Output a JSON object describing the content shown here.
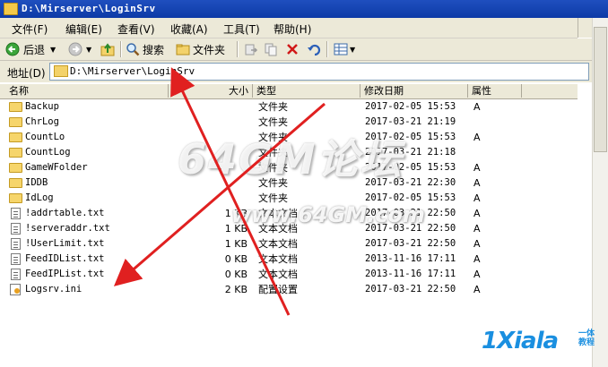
{
  "window": {
    "title": "D:\\Mirserver\\LoginSrv"
  },
  "menu": [
    "文件(F)",
    "编辑(E)",
    "查看(V)",
    "收藏(A)",
    "工具(T)",
    "帮助(H)"
  ],
  "toolbar": {
    "back": "后退",
    "search": "搜索",
    "folders": "文件夹"
  },
  "address": {
    "label": "地址(D)",
    "value": "D:\\Mirserver\\LoginSrv"
  },
  "columns": {
    "name": "名称",
    "size": "大小",
    "type": "类型",
    "modified": "修改日期",
    "attr": "属性"
  },
  "files": [
    {
      "name": "Backup",
      "size": "",
      "type": "文件夹",
      "date": "2017-02-05 15:53",
      "attr": "A",
      "kind": "folder"
    },
    {
      "name": "ChrLog",
      "size": "",
      "type": "文件夹",
      "date": "2017-03-21 21:19",
      "attr": "",
      "kind": "folder"
    },
    {
      "name": "CountLo",
      "size": "",
      "type": "文件夹",
      "date": "2017-02-05 15:53",
      "attr": "A",
      "kind": "folder"
    },
    {
      "name": "CountLog",
      "size": "",
      "type": "文件夹",
      "date": "2017-03-21 21:18",
      "attr": "",
      "kind": "folder"
    },
    {
      "name": "GameWFolder",
      "size": "",
      "type": "文件夹",
      "date": "2017-02-05 15:53",
      "attr": "A",
      "kind": "folder"
    },
    {
      "name": "IDDB",
      "size": "",
      "type": "文件夹",
      "date": "2017-03-21 22:30",
      "attr": "A",
      "kind": "folder"
    },
    {
      "name": "IdLog",
      "size": "",
      "type": "文件夹",
      "date": "2017-02-05 15:53",
      "attr": "A",
      "kind": "folder"
    },
    {
      "name": "!addrtable.txt",
      "size": "1 KB",
      "type": "文本文档",
      "date": "2017-03-21 22:50",
      "attr": "A",
      "kind": "file"
    },
    {
      "name": "!serveraddr.txt",
      "size": "1 KB",
      "type": "文本文档",
      "date": "2017-03-21 22:50",
      "attr": "A",
      "kind": "file"
    },
    {
      "name": "!UserLimit.txt",
      "size": "1 KB",
      "type": "文本文档",
      "date": "2017-03-21 22:50",
      "attr": "A",
      "kind": "file"
    },
    {
      "name": "FeedIDList.txt",
      "size": "0 KB",
      "type": "文本文档",
      "date": "2013-11-16 17:11",
      "attr": "A",
      "kind": "file"
    },
    {
      "name": "FeedIPList.txt",
      "size": "0 KB",
      "type": "文本文档",
      "date": "2013-11-16 17:11",
      "attr": "A",
      "kind": "file"
    },
    {
      "name": "Logsrv.ini",
      "size": "2 KB",
      "type": "配置设置",
      "date": "2017-03-21 22:50",
      "attr": "A",
      "kind": "ini"
    }
  ],
  "watermark": {
    "main": "64GM论坛",
    "url": "www.64GM.com"
  },
  "brand": {
    "logo": "1Xiala",
    "tag": "一体 教程"
  },
  "colors": {
    "titlebar": "#1f4fbf",
    "chrome": "#ece9d8",
    "arrow": "#e02020",
    "brand": "#1a8fe0"
  }
}
